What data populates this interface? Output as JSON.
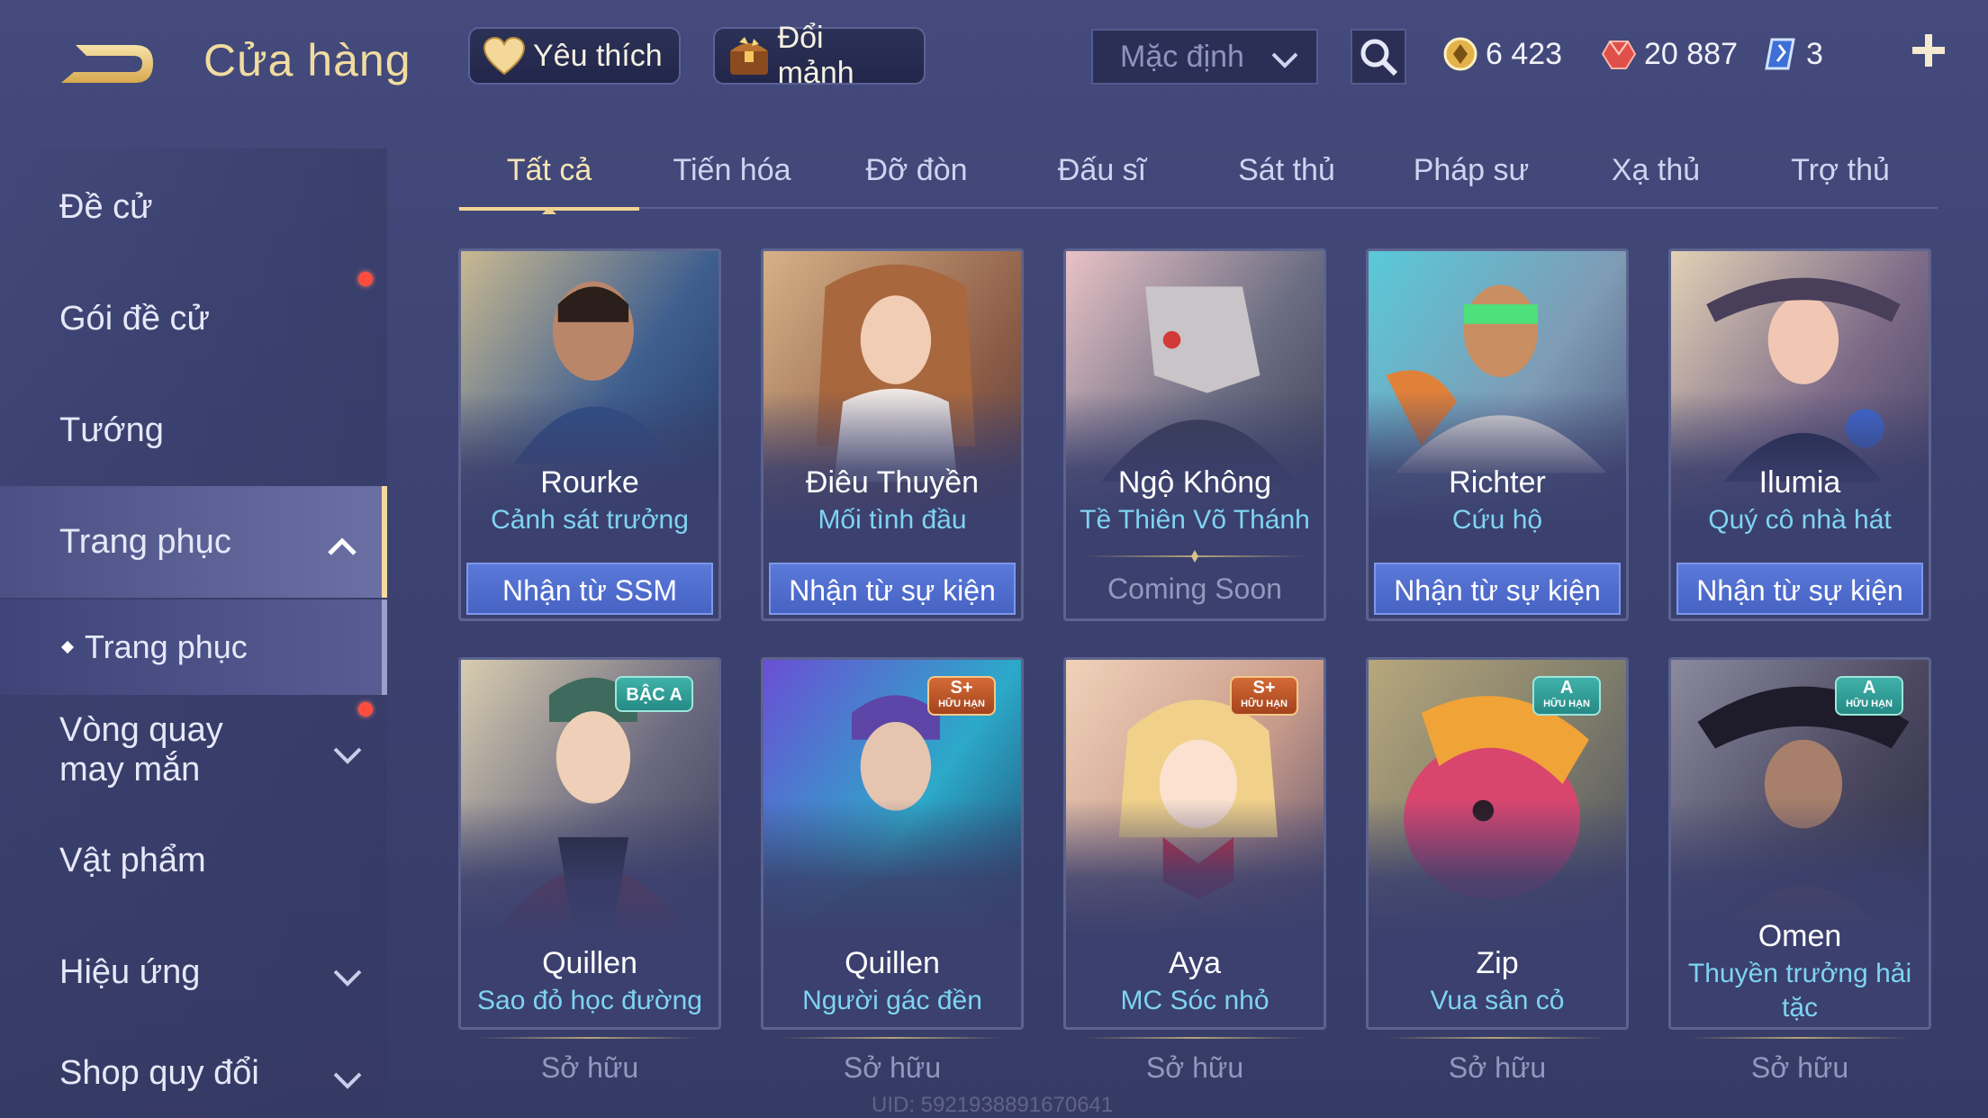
{
  "header": {
    "title": "Cửa hàng",
    "favorites_label": "Yêu thích",
    "exchange_label": "Đổi mảnh",
    "sort_value": "Mặc định",
    "currencies": [
      {
        "icon": "gold-coin-icon",
        "value": "6 423"
      },
      {
        "icon": "ruby-voucher-icon",
        "value": "20 887"
      },
      {
        "icon": "crystal-icon",
        "value": "3"
      }
    ]
  },
  "sidebar": {
    "items": [
      {
        "label": "Đề cử"
      },
      {
        "label": "Gói đề cử"
      },
      {
        "label": "Tướng"
      },
      {
        "label": "Trang phục"
      },
      {
        "label": "Trang phục"
      },
      {
        "label": "Vòng quay may mắn"
      },
      {
        "label": "Vật phẩm"
      },
      {
        "label": "Hiệu ứng"
      },
      {
        "label": "Shop quy đổi"
      }
    ]
  },
  "tabs": [
    "Tất cả",
    "Tiến hóa",
    "Đỡ đòn",
    "Đấu sĩ",
    "Sát thủ",
    "Pháp sư",
    "Xạ thủ",
    "Trợ thủ"
  ],
  "cards": [
    {
      "hero": "Rourke",
      "skin": "Cảnh sát trưởng",
      "action": "Nhận từ SSM",
      "action_type": "button",
      "badge": ""
    },
    {
      "hero": "Điêu Thuyền",
      "skin": "Mối tình đầu",
      "action": "Nhận từ sự kiện",
      "action_type": "button",
      "badge": ""
    },
    {
      "hero": "Ngộ Không",
      "skin": "Tề Thiên Võ Thánh",
      "action": "Coming Soon",
      "action_type": "muted",
      "badge": ""
    },
    {
      "hero": "Richter",
      "skin": "Cứu hộ",
      "action": "Nhận từ sự kiện",
      "action_type": "button",
      "badge": ""
    },
    {
      "hero": "Ilumia",
      "skin": "Quý cô nhà hát",
      "action": "Nhận từ sự kiện",
      "action_type": "button",
      "badge": ""
    },
    {
      "hero": "Quillen",
      "skin": "Sao đỏ học đường",
      "action": "Sở hữu",
      "action_type": "muted",
      "badge": "BẬC A",
      "badge_sub": ""
    },
    {
      "hero": "Quillen",
      "skin": "Người gác đền",
      "action": "Sở hữu",
      "action_type": "muted",
      "badge": "S+",
      "badge_sub": "HỮU HẠN"
    },
    {
      "hero": "Aya",
      "skin": "MC Sóc nhỏ",
      "action": "Sở hữu",
      "action_type": "muted",
      "badge": "S+",
      "badge_sub": "HỮU HẠN"
    },
    {
      "hero": "Zip",
      "skin": "Vua sân cỏ",
      "action": "Sở hữu",
      "action_type": "muted",
      "badge": "A",
      "badge_sub": "HỮU HẠN"
    },
    {
      "hero": "Omen",
      "skin": "Thuyền trưởng hải tặc",
      "action": "Sở hữu",
      "action_type": "muted",
      "badge": "A",
      "badge_sub": "HỮU HẠN"
    }
  ],
  "footer": {
    "uid": "UID: 5921938891670641"
  },
  "colors": {
    "accent_gold": "#f1d493",
    "skin_name": "#7fd3f2",
    "action_button": "#4f6dcc",
    "notify_dot": "#ff4d3d"
  }
}
